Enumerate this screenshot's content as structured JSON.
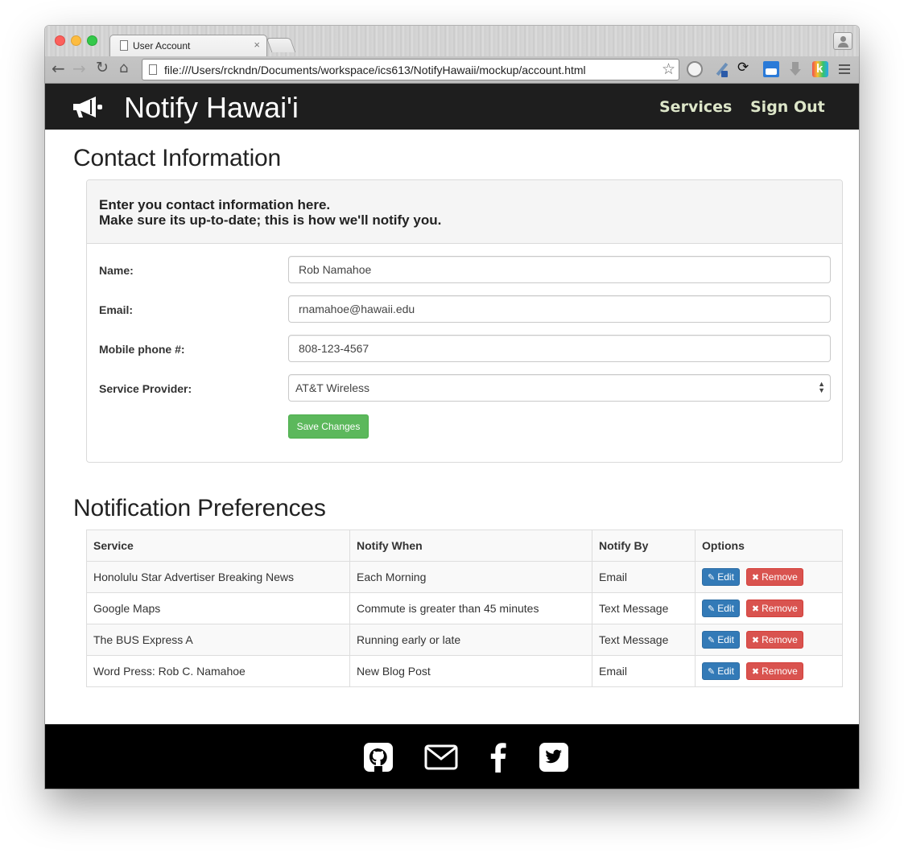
{
  "browser": {
    "tab_title": "User Account",
    "tab_close": "×",
    "url": "file:///Users/rckndn/Documents/workspace/ics613/NotifyHawaii/mockup/account.html",
    "back_glyph": "←",
    "forward_glyph": "→",
    "reload_glyph": "↻",
    "home_glyph": "⌂",
    "star_glyph": "☆",
    "ext_k_label": "k"
  },
  "navbar": {
    "brand": "Notify Hawai'i",
    "brand_icon": "megaphone-icon",
    "links": [
      "Services",
      "Sign Out"
    ],
    "link_color": "#dde6c9",
    "background": "#1e1e1e"
  },
  "contact": {
    "title": "Contact Information",
    "intro_line1": "Enter you contact information here.",
    "intro_line2": "Make sure its up-to-date; this is how we'll notify you.",
    "fields": [
      {
        "label": "Name:",
        "value": "Rob Namahoe"
      },
      {
        "label": "Email:",
        "value": "rnamahoe@hawaii.edu"
      },
      {
        "label": "Mobile phone #:",
        "value": "808-123-4567"
      },
      {
        "label": "Service Provider:",
        "value": "AT&T Wireless"
      }
    ],
    "save_label": "Save Changes",
    "save_color": "#5cb85c"
  },
  "preferences": {
    "title": "Notification Preferences",
    "headers": [
      "Service",
      "Notify When",
      "Notify By",
      "Options"
    ],
    "rows": [
      {
        "service": "Honolulu Star Advertiser Breaking News",
        "when": "Each Morning",
        "by": "Email"
      },
      {
        "service": "Google Maps",
        "when": "Commute is greater than 45 minutes",
        "by": "Text Message"
      },
      {
        "service": "The BUS Express A",
        "when": "Running early or late",
        "by": "Text Message"
      },
      {
        "service": "Word Press: Rob C. Namahoe",
        "when": "New Blog Post",
        "by": "Email"
      }
    ],
    "edit_label": "Edit",
    "remove_label": "Remove",
    "edit_icon": "pencil-icon",
    "remove_icon": "x-icon",
    "edit_color": "#337ab7",
    "remove_color": "#d9534f"
  },
  "footer": {
    "icons": [
      "github-icon",
      "mail-icon",
      "facebook-icon",
      "twitter-icon"
    ],
    "background": "#000000"
  }
}
